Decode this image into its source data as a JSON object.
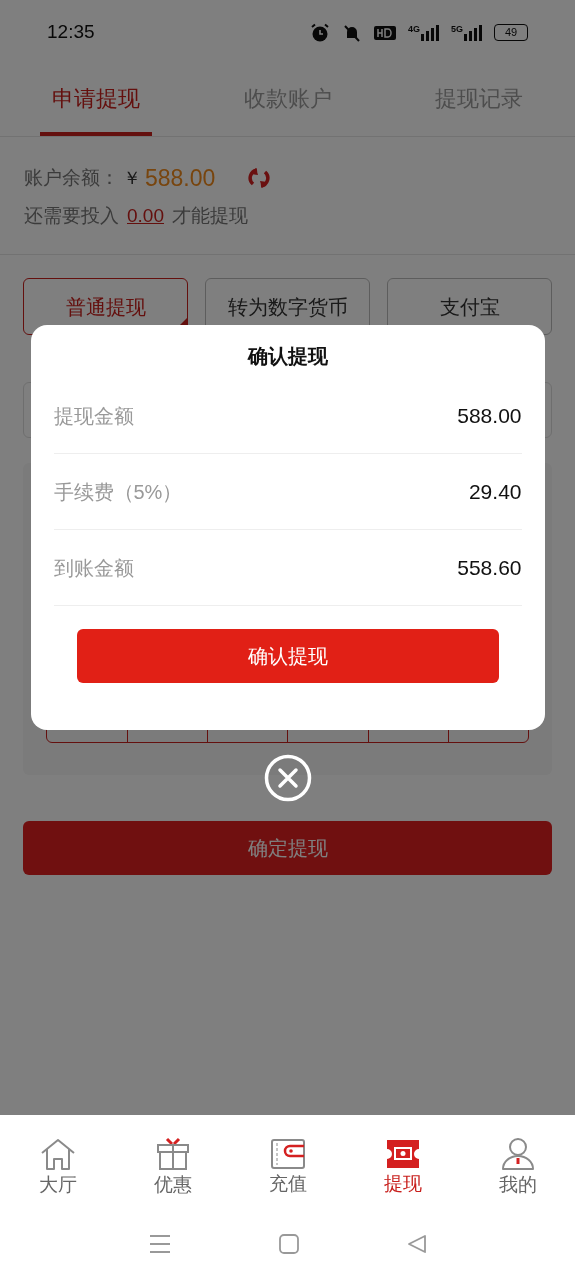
{
  "status_bar": {
    "time": "12:35",
    "network_labels": [
      "4G",
      "5G"
    ],
    "battery": "49"
  },
  "tabs": [
    {
      "label": "申请提现",
      "selected": true
    },
    {
      "label": "收款账户",
      "selected": false
    },
    {
      "label": "提现记录",
      "selected": false
    }
  ],
  "balance": {
    "label": "账户余额：",
    "currency": "￥",
    "amount": "588.00",
    "need_prefix": "还需要投入",
    "need_amount": "0.00",
    "need_suffix": "才能提现"
  },
  "methods": [
    {
      "label": "普通提现",
      "selected": true
    },
    {
      "label": "转为数字货币",
      "selected": false
    },
    {
      "label": "支付宝",
      "selected": false
    }
  ],
  "submit_button": "确定提现",
  "dialog": {
    "title": "确认提现",
    "rows": [
      {
        "label": "提现金额",
        "value": "588.00"
      },
      {
        "label": "手续费（5%）",
        "value": "29.40"
      },
      {
        "label": "到账金额",
        "value": "558.60"
      }
    ],
    "confirm": "确认提现"
  },
  "bottom_nav": [
    {
      "label": "大厅",
      "kind": "home",
      "selected": false
    },
    {
      "label": "优惠",
      "kind": "gift",
      "selected": false
    },
    {
      "label": "充值",
      "kind": "wallet",
      "selected": false
    },
    {
      "label": "提现",
      "kind": "cash",
      "selected": true
    },
    {
      "label": "我的",
      "kind": "user",
      "selected": false
    }
  ]
}
